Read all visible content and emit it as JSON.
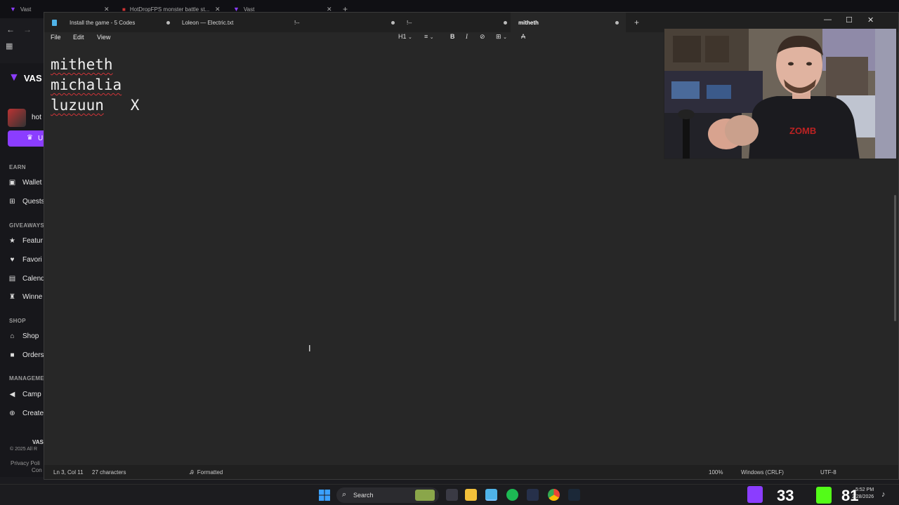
{
  "browser": {
    "tabs": [
      {
        "label": "Vast",
        "close": "✕"
      },
      {
        "label": "HotDropFPS monster battle st...",
        "close": "✕"
      },
      {
        "label": "Vast",
        "close": "✕"
      }
    ],
    "new_tab": "+"
  },
  "vast": {
    "brand": "VAS",
    "user": "hot",
    "upgrade_label": "U",
    "sections": {
      "earn": "EARN",
      "giveaways": "GIVEAWAYS",
      "shop": "SHOP",
      "management": "MANAGEME"
    },
    "earn_items": [
      "Wallet",
      "Quests"
    ],
    "giveaway_items": [
      "Featur",
      "Favori",
      "Calend",
      "Winne"
    ],
    "shop_items": [
      "Shop",
      "Orders"
    ],
    "management_items": [
      "Camp",
      "Create"
    ],
    "footer_brand": "VAS",
    "copyright": "© 2025 All R",
    "privacy": "Privacy Poli",
    "privacy2": "Con"
  },
  "notepad": {
    "tabs": [
      {
        "label": "Install the game - 5 Codes"
      },
      {
        "label": "Loleon — Electric.txt"
      },
      {
        "label": "!--"
      },
      {
        "label": "!--"
      },
      {
        "label": "mitheth"
      }
    ],
    "new_tab": "+",
    "window_controls": {
      "minimize": "—",
      "maximize": "☐",
      "close": "✕"
    },
    "menu": {
      "file": "File",
      "edit": "Edit",
      "view": "View"
    },
    "toolbar": {
      "heading": "H1",
      "list": "≡",
      "bold": "B",
      "italic": "I",
      "link": "⊘",
      "table": "⊞",
      "clear": "A"
    },
    "lines": [
      {
        "word": "mitheth",
        "suffix": ""
      },
      {
        "word": "michalia",
        "suffix": ""
      },
      {
        "word": "luzuun",
        "suffix": "   X"
      }
    ],
    "status": {
      "position": "Ln 3, Col 11",
      "characters": "27 characters",
      "format": "Formatted",
      "zoom": "100%",
      "line_endings": "Windows (CRLF)",
      "encoding": "UTF-8"
    }
  },
  "taskbar": {
    "search_label": "Search",
    "counter_left": "33",
    "counter_right": "81",
    "time": "5:52 PM",
    "date": "2/28/2026"
  },
  "colors": {
    "accent": "#8b3dff",
    "editor_bg": "#272727",
    "spell_error": "#d13438"
  }
}
